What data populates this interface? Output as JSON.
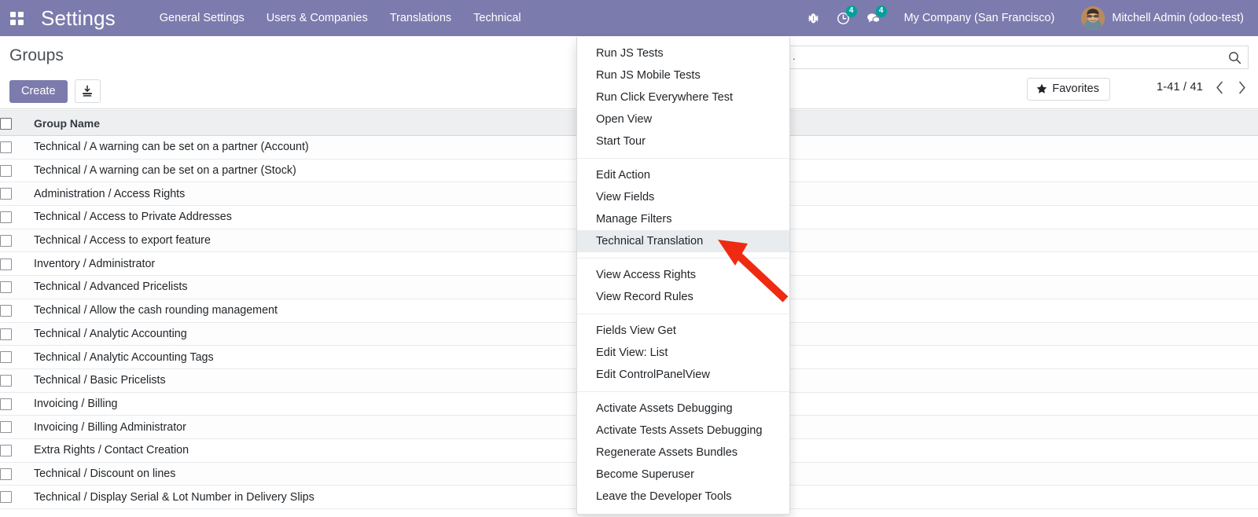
{
  "navbar": {
    "apps_icon": "apps-grid-icon",
    "brand": "Settings",
    "menu_items": [
      {
        "label": "General Settings"
      },
      {
        "label": "Users & Companies"
      },
      {
        "label": "Translations"
      },
      {
        "label": "Technical"
      }
    ],
    "debug_icon": "bug-icon",
    "activity": {
      "icon": "clock-icon",
      "count": "4"
    },
    "messaging": {
      "icon": "chat-bubble-icon",
      "count": "4"
    },
    "company": "My Company (San Francisco)",
    "user": "Mitchell Admin (odoo-test)",
    "avatar_icon": "user-avatar"
  },
  "control_panel": {
    "title": "Groups",
    "create_label": "Create",
    "import_icon": "import-download-icon",
    "favorites_label": "Favorites",
    "favorites_icon": "star-icon",
    "search": {
      "value": ".",
      "placeholder": "",
      "icon": "search-icon"
    },
    "pager": {
      "value": "1-41 / 41",
      "prev_icon": "chevron-left-icon",
      "next_icon": "chevron-right-icon"
    }
  },
  "list": {
    "columns": [
      "Group Name"
    ],
    "select_all_checkbox": false,
    "rows": [
      {
        "name": "Technical / A warning can be set on a partner (Account)"
      },
      {
        "name": "Technical / A warning can be set on a partner (Stock)"
      },
      {
        "name": "Administration / Access Rights"
      },
      {
        "name": "Technical / Access to Private Addresses"
      },
      {
        "name": "Technical / Access to export feature"
      },
      {
        "name": "Inventory / Administrator"
      },
      {
        "name": "Technical / Advanced Pricelists"
      },
      {
        "name": "Technical / Allow the cash rounding management"
      },
      {
        "name": "Technical / Analytic Accounting"
      },
      {
        "name": "Technical / Analytic Accounting Tags"
      },
      {
        "name": "Technical / Basic Pricelists"
      },
      {
        "name": "Invoicing / Billing"
      },
      {
        "name": "Invoicing / Billing Administrator"
      },
      {
        "name": "Extra Rights / Contact Creation"
      },
      {
        "name": "Technical / Discount on lines"
      },
      {
        "name": "Technical / Display Serial & Lot Number in Delivery Slips"
      }
    ]
  },
  "debug_menu": {
    "groups": [
      {
        "items": [
          {
            "label": "Run JS Tests",
            "active": false
          },
          {
            "label": "Run JS Mobile Tests",
            "active": false
          },
          {
            "label": "Run Click Everywhere Test",
            "active": false
          },
          {
            "label": "Open View",
            "active": false
          },
          {
            "label": "Start Tour",
            "active": false
          }
        ]
      },
      {
        "items": [
          {
            "label": "Edit Action",
            "active": false
          },
          {
            "label": "View Fields",
            "active": false
          },
          {
            "label": "Manage Filters",
            "active": false
          },
          {
            "label": "Technical Translation",
            "active": true
          }
        ]
      },
      {
        "items": [
          {
            "label": "View Access Rights",
            "active": false
          },
          {
            "label": "View Record Rules",
            "active": false
          }
        ]
      },
      {
        "items": [
          {
            "label": "Fields View Get",
            "active": false
          },
          {
            "label": "Edit View: List",
            "active": false
          },
          {
            "label": "Edit ControlPanelView",
            "active": false
          }
        ]
      },
      {
        "items": [
          {
            "label": "Activate Assets Debugging",
            "active": false
          },
          {
            "label": "Activate Tests Assets Debugging",
            "active": false
          },
          {
            "label": "Regenerate Assets Bundles",
            "active": false
          },
          {
            "label": "Become Superuser",
            "active": false
          },
          {
            "label": "Leave the Developer Tools",
            "active": false
          }
        ]
      }
    ]
  },
  "annotation": {
    "arrow_color": "#ee2b12",
    "target": "Technical Translation"
  },
  "colors": {
    "brand_purple": "#7c7bad",
    "badge_teal": "#00a09d",
    "menu_active_bg": "#e9ecef",
    "arrow_red": "#ee2b12"
  }
}
